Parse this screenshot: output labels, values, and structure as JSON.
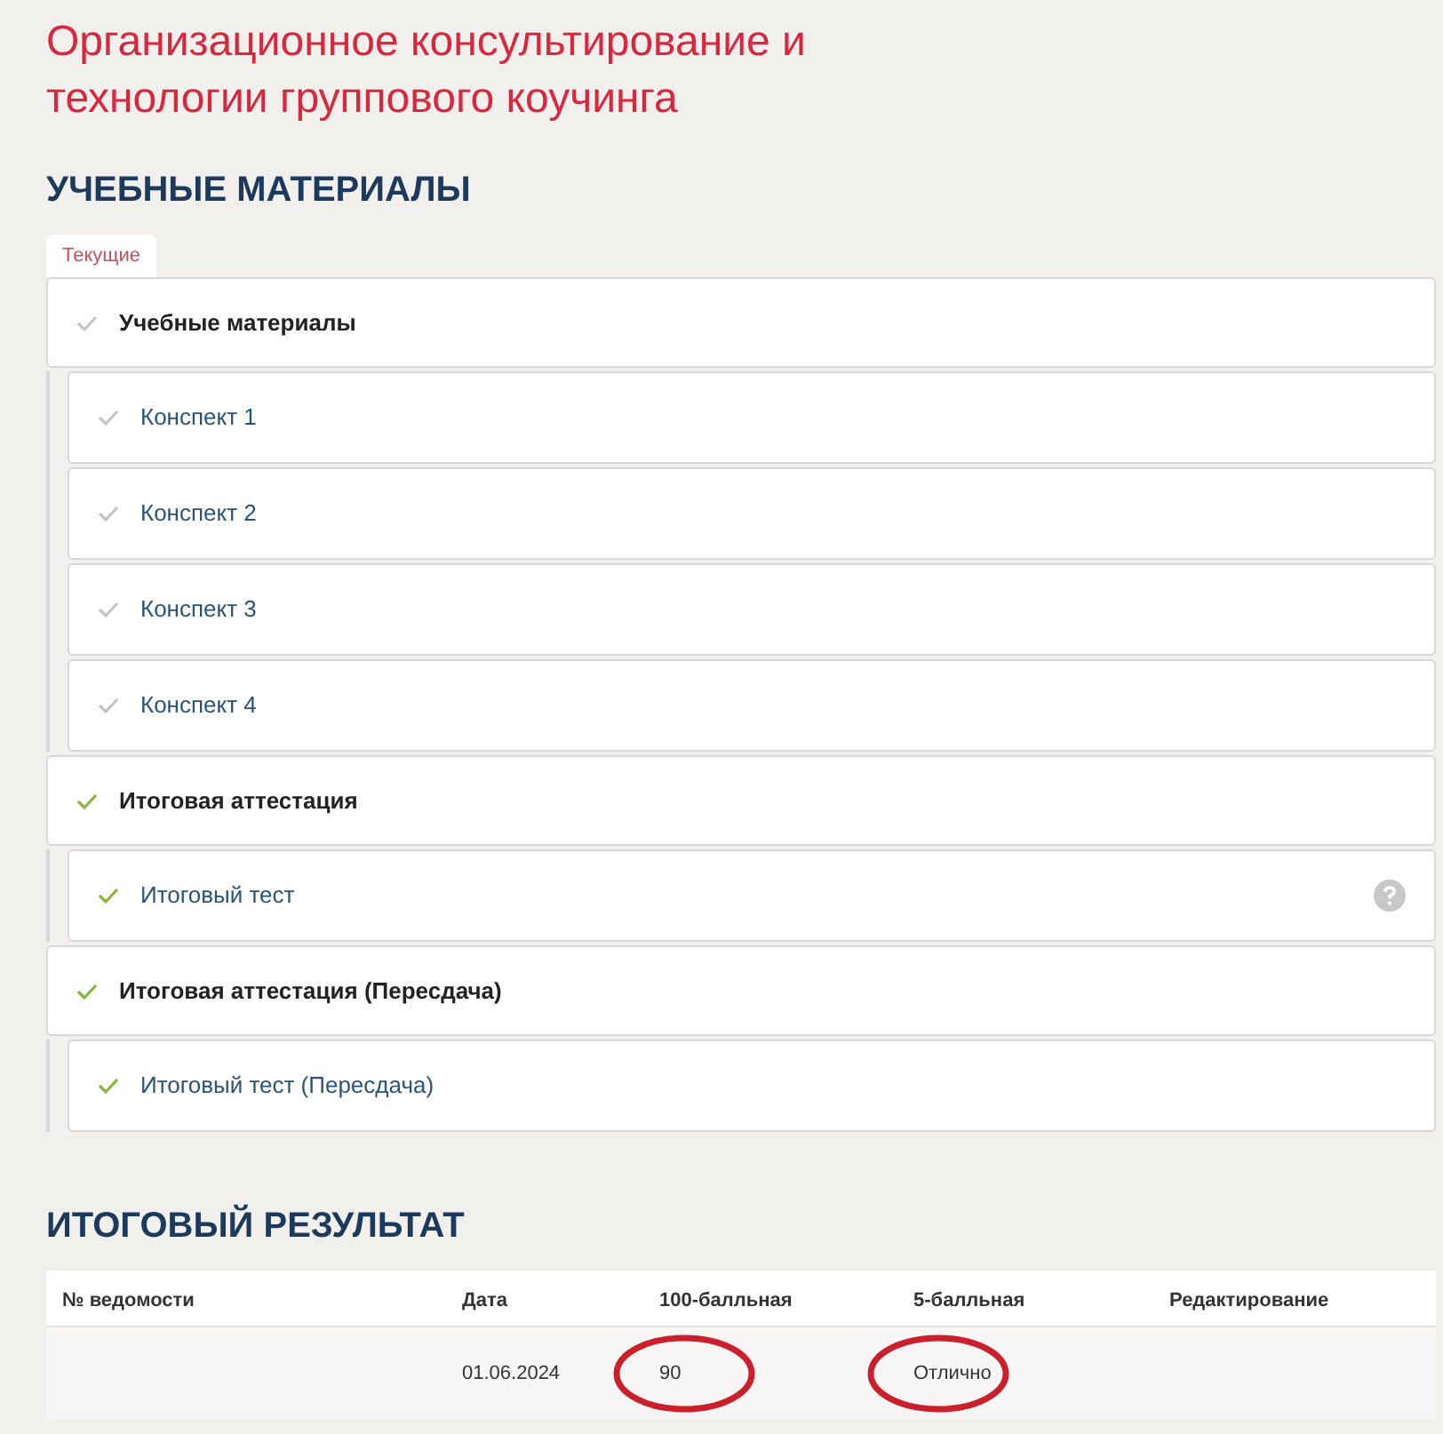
{
  "title": "Организационное консультирование и технологии группового коучинга",
  "materials": {
    "heading": "УЧЕБНЫЕ МАТЕРИАЛЫ",
    "tabs": [
      {
        "label": "Текущие",
        "selected": true
      }
    ],
    "groups": [
      {
        "title": "Учебные материалы",
        "completed": false,
        "children": [
          {
            "title": "Конспект 1",
            "completed": false,
            "help": false
          },
          {
            "title": "Конспект 2",
            "completed": false,
            "help": false
          },
          {
            "title": "Конспект 3",
            "completed": false,
            "help": false
          },
          {
            "title": "Конспект 4",
            "completed": false,
            "help": false
          }
        ]
      },
      {
        "title": "Итоговая аттестация",
        "completed": true,
        "children": [
          {
            "title": "Итоговый тест",
            "completed": true,
            "help": true
          }
        ]
      },
      {
        "title": "Итоговая аттестация (Пересдача)",
        "completed": true,
        "children": [
          {
            "title": "Итоговый тест (Пересдача)",
            "completed": true,
            "help": false
          }
        ]
      }
    ]
  },
  "result": {
    "heading": "ИТОГОВЫЙ РЕЗУЛЬТАТ",
    "columns": [
      "№ ведомости",
      "Дата",
      "100-балльная",
      "5-балльная",
      "Редактирование"
    ],
    "rows": [
      {
        "cells": [
          {
            "text": "",
            "circled": false
          },
          {
            "text": "01.06.2024",
            "circled": false
          },
          {
            "text": "90",
            "circled": true
          },
          {
            "text": "Отлично",
            "circled": true
          },
          {
            "text": "",
            "circled": false
          }
        ]
      }
    ]
  }
}
